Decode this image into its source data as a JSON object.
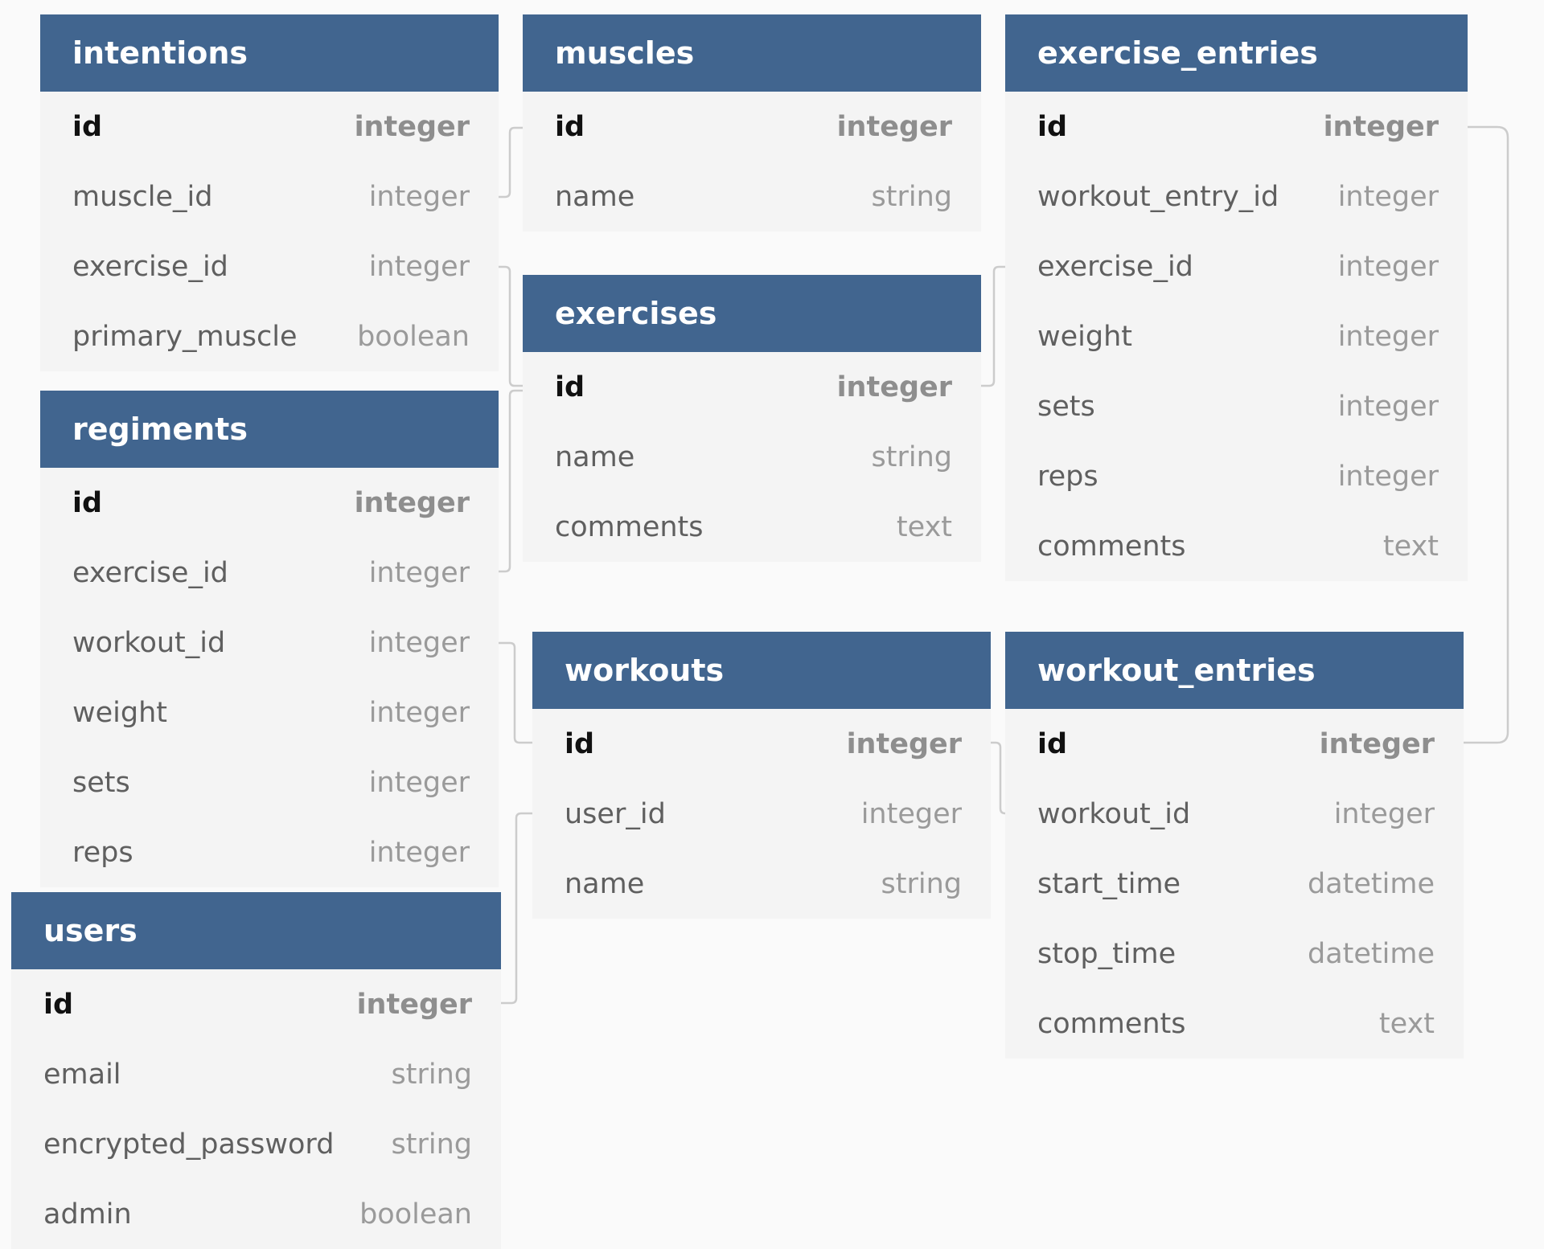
{
  "tables": {
    "intentions": {
      "title": "intentions",
      "columns": [
        {
          "name": "id",
          "type": "integer"
        },
        {
          "name": "muscle_id",
          "type": "integer"
        },
        {
          "name": "exercise_id",
          "type": "integer"
        },
        {
          "name": "primary_muscle",
          "type": "boolean"
        }
      ]
    },
    "regiments": {
      "title": "regiments",
      "columns": [
        {
          "name": "id",
          "type": "integer"
        },
        {
          "name": "exercise_id",
          "type": "integer"
        },
        {
          "name": "workout_id",
          "type": "integer"
        },
        {
          "name": "weight",
          "type": "integer"
        },
        {
          "name": "sets",
          "type": "integer"
        },
        {
          "name": "reps",
          "type": "integer"
        }
      ]
    },
    "users": {
      "title": "users",
      "columns": [
        {
          "name": "id",
          "type": "integer"
        },
        {
          "name": "email",
          "type": "string"
        },
        {
          "name": "encrypted_password",
          "type": "string"
        },
        {
          "name": "admin",
          "type": "boolean"
        }
      ]
    },
    "muscles": {
      "title": "muscles",
      "columns": [
        {
          "name": "id",
          "type": "integer"
        },
        {
          "name": "name",
          "type": "string"
        }
      ]
    },
    "exercises": {
      "title": "exercises",
      "columns": [
        {
          "name": "id",
          "type": "integer"
        },
        {
          "name": "name",
          "type": "string"
        },
        {
          "name": "comments",
          "type": "text"
        }
      ]
    },
    "workouts": {
      "title": "workouts",
      "columns": [
        {
          "name": "id",
          "type": "integer"
        },
        {
          "name": "user_id",
          "type": "integer"
        },
        {
          "name": "name",
          "type": "string"
        }
      ]
    },
    "exercise_entries": {
      "title": "exercise_entries",
      "columns": [
        {
          "name": "id",
          "type": "integer"
        },
        {
          "name": "workout_entry_id",
          "type": "integer"
        },
        {
          "name": "exercise_id",
          "type": "integer"
        },
        {
          "name": "weight",
          "type": "integer"
        },
        {
          "name": "sets",
          "type": "integer"
        },
        {
          "name": "reps",
          "type": "integer"
        },
        {
          "name": "comments",
          "type": "text"
        }
      ]
    },
    "workout_entries": {
      "title": "workout_entries",
      "columns": [
        {
          "name": "id",
          "type": "integer"
        },
        {
          "name": "workout_id",
          "type": "integer"
        },
        {
          "name": "start_time",
          "type": "datetime"
        },
        {
          "name": "stop_time",
          "type": "datetime"
        },
        {
          "name": "comments",
          "type": "text"
        }
      ]
    }
  },
  "relations": [
    {
      "from": "intentions.muscle_id",
      "to": "muscles.id"
    },
    {
      "from": "intentions.exercise_id",
      "to": "exercises.id"
    },
    {
      "from": "regiments.exercise_id",
      "to": "exercises.id"
    },
    {
      "from": "regiments.workout_id",
      "to": "workouts.id"
    },
    {
      "from": "users.id",
      "to": "workouts.user_id"
    },
    {
      "from": "exercise_entries.exercise_id",
      "to": "exercises.id"
    },
    {
      "from": "exercise_entries.id",
      "to": "workout_entries.id"
    },
    {
      "from": "workouts.id",
      "to": "workout_entries.workout_id"
    }
  ],
  "colors": {
    "header": "#41658f",
    "body": "#f4f4f4",
    "background": "#fafafa",
    "connector": "#cccccc"
  }
}
